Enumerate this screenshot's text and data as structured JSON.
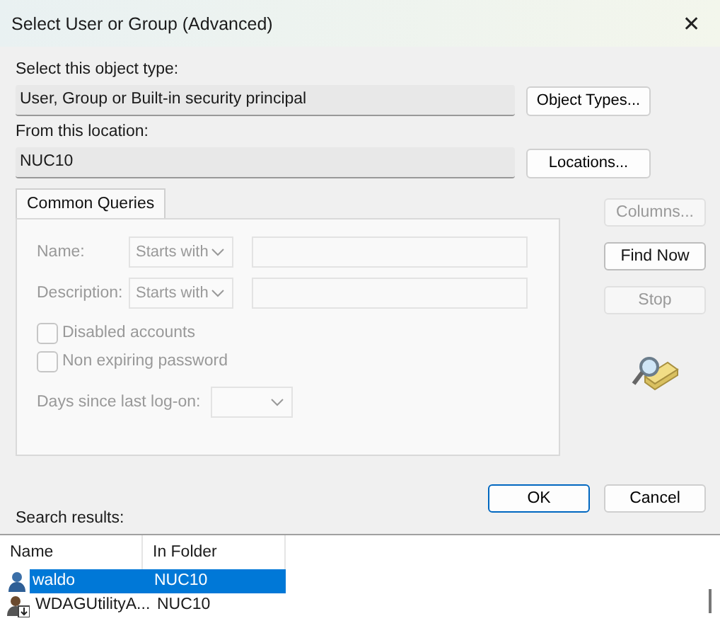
{
  "window": {
    "title": "Select User or Group (Advanced)",
    "close": "✕"
  },
  "object_type": {
    "label": "Select this object type:",
    "value": "User, Group or Built-in security principal",
    "button": "Object Types..."
  },
  "location": {
    "label": "From this location:",
    "value": "NUC10",
    "button": "Locations..."
  },
  "tabs": [
    {
      "label": "Common Queries",
      "selected": true
    }
  ],
  "queries": [
    {
      "label": "Name:",
      "operator": "Starts with",
      "disabled": true
    },
    {
      "label": "Description:",
      "operator": "Starts with",
      "disabled": true
    }
  ],
  "checkboxes": [
    {
      "label": "Disabled accounts",
      "checked": false,
      "disabled": true
    },
    {
      "label": "Non expiring password",
      "checked": false,
      "disabled": true
    }
  ],
  "days_label": "Days since last log-on:",
  "side_buttons": [
    {
      "label": "Columns...",
      "disabled": true
    },
    {
      "label": "Find Now",
      "disabled": false
    },
    {
      "label": "Stop",
      "disabled": true
    }
  ],
  "ok": "OK",
  "cancel": "Cancel",
  "results_label": "Search results:",
  "columns": [
    "Name",
    "In Folder"
  ],
  "rows": [
    {
      "name": "waldo",
      "folder": "NUC10",
      "kind": "user",
      "selected": true
    },
    {
      "name": "WDAGUtilityA...",
      "folder": "NUC10",
      "kind": "system",
      "selected": false
    }
  ]
}
